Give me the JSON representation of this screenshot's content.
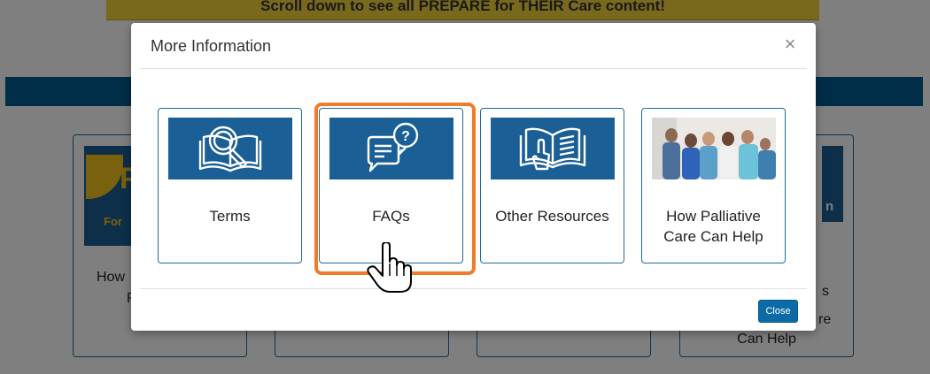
{
  "background": {
    "banner_text": "Scroll down to see all PREPARE for THEIR Care content!",
    "card1_fragment_a": "How",
    "card1_fragment_b": "P",
    "card1_logo_letter": "P",
    "card1_logo_word": "For",
    "card4_fragment_a": "s",
    "card4_fragment_b": "re",
    "card4_label_tail": "Can Help",
    "card4_thumb_fragment": "n"
  },
  "modal": {
    "title": "More Information",
    "close_icon": "×",
    "tiles": [
      {
        "label": "Terms",
        "icon": "book-magnifier-icon"
      },
      {
        "label": "FAQs",
        "icon": "chat-question-icon"
      },
      {
        "label": "Other Resources",
        "icon": "open-book-pointer-icon"
      },
      {
        "label_line1": "How Palliative",
        "label_line2": "Care Can Help",
        "icon": "care-team-photo"
      }
    ],
    "close_button": "Close"
  },
  "colors": {
    "accent_blue": "#1a5f95",
    "highlight_orange": "#ef7b2c",
    "banner_yellow": "#f2d33b"
  }
}
